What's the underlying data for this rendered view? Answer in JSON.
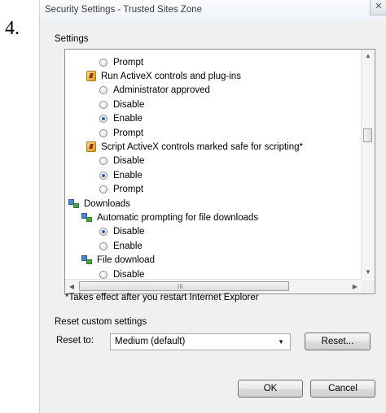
{
  "step_number": "4.",
  "window": {
    "title": "Security Settings - Trusted Sites Zone",
    "close_glyph": "✕"
  },
  "settings": {
    "label": "Settings",
    "items": [
      {
        "type": "radio",
        "label": "Prompt",
        "checked": false
      },
      {
        "type": "activex-group",
        "label": "Run ActiveX controls and plug-ins"
      },
      {
        "type": "radio",
        "label": "Administrator approved",
        "checked": false
      },
      {
        "type": "radio",
        "label": "Disable",
        "checked": false
      },
      {
        "type": "radio",
        "label": "Enable",
        "checked": true
      },
      {
        "type": "radio",
        "label": "Prompt",
        "checked": false
      },
      {
        "type": "activex-group",
        "label": "Script ActiveX controls marked safe for scripting*"
      },
      {
        "type": "radio",
        "label": "Disable",
        "checked": false
      },
      {
        "type": "radio",
        "label": "Enable",
        "checked": true
      },
      {
        "type": "radio",
        "label": "Prompt",
        "checked": false
      },
      {
        "type": "downloads-group",
        "label": "Downloads"
      },
      {
        "type": "downloads-subgroup",
        "label": "Automatic prompting for file downloads"
      },
      {
        "type": "radio",
        "label": "Disable",
        "checked": true
      },
      {
        "type": "radio",
        "label": "Enable",
        "checked": false
      },
      {
        "type": "downloads-subgroup",
        "label": "File download"
      },
      {
        "type": "radio",
        "label": "Disable",
        "checked": false
      }
    ],
    "h_scroll_grip": "III"
  },
  "note": "*Takes effect after you restart Internet Explorer",
  "reset": {
    "section_label": "Reset custom settings",
    "reset_to_label": "Reset to:",
    "selected": "Medium (default)",
    "reset_button": "Reset..."
  },
  "buttons": {
    "ok": "OK",
    "cancel": "Cancel"
  },
  "icons": {
    "activex": "activex-shield-icon",
    "downloads": "download-icon"
  },
  "colors": {
    "dialog_bg": "#f0f0f0",
    "radio_selected": "#2d5fa8"
  }
}
